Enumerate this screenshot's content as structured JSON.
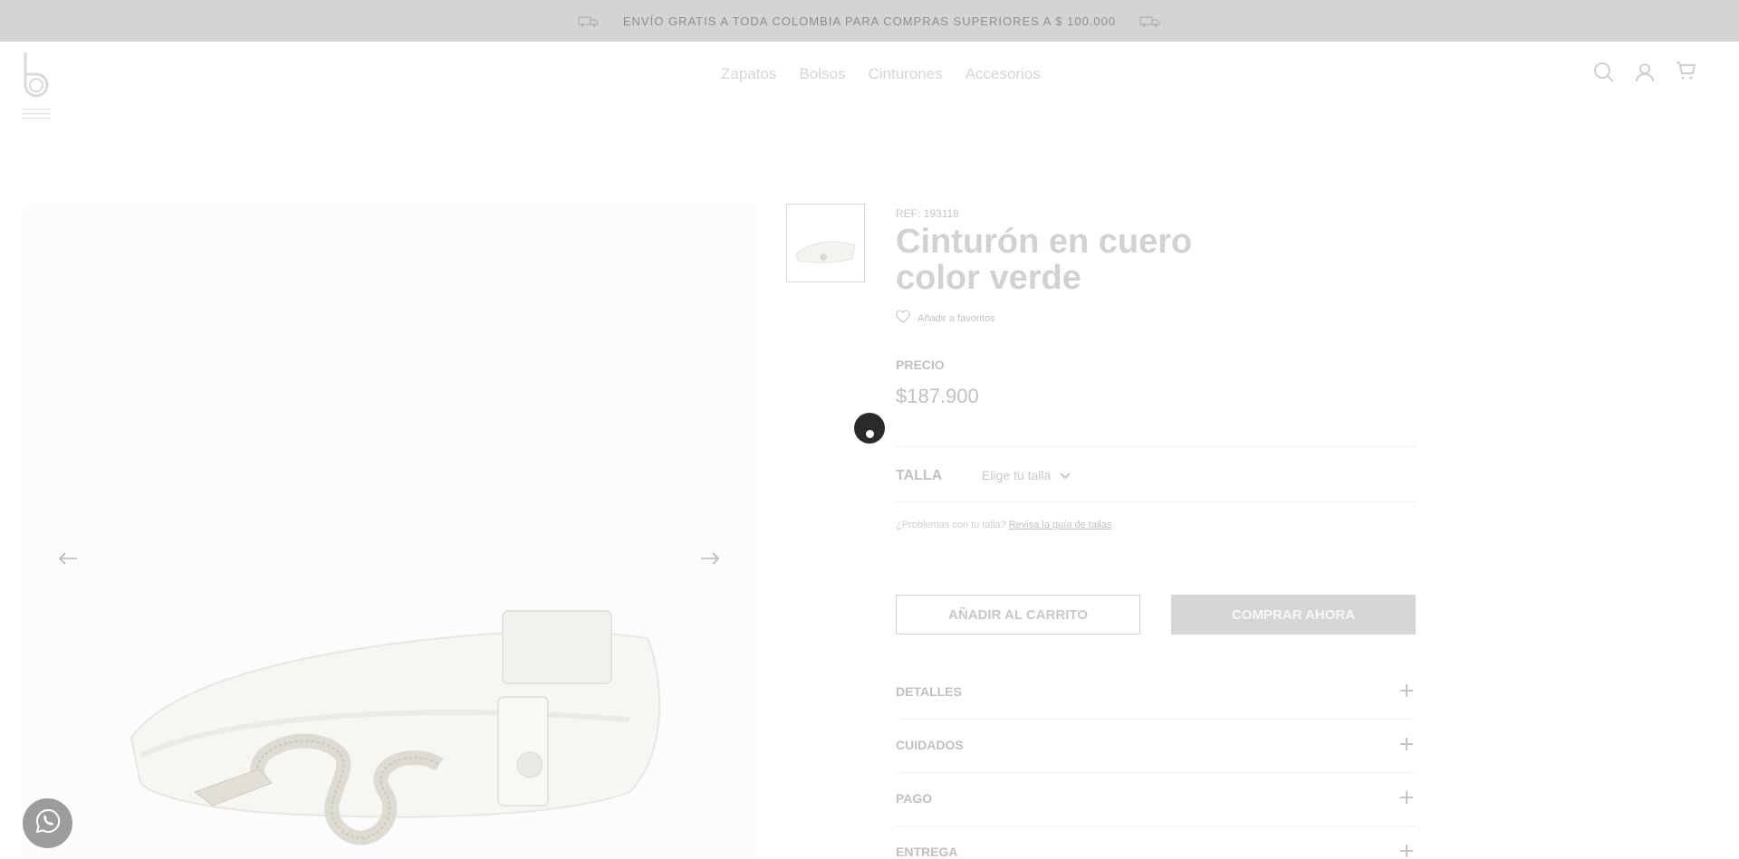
{
  "announcement": {
    "text": "ENVÍO GRATIS A TODA COLOMBIA PARA COMPRAS SUPERIORES A $ 100.000",
    "icon": "truck-icon"
  },
  "header": {
    "logo": "b",
    "nav": [
      "Zapatos",
      "Bolsos",
      "Cinturones",
      "Accesorios"
    ],
    "icons": [
      "search-icon",
      "user-icon",
      "cart-icon"
    ]
  },
  "product": {
    "ref": "REF: 193118",
    "title": "Cinturón en cuero color verde",
    "favorites_label": "Añadir a favoritos",
    "price_label": "PRECIO",
    "price": "$187.900",
    "size_label": "TALLA",
    "size_placeholder": "Elige tu talla",
    "help_text": "¿Problemas con tu talla?",
    "help_link": "Revisa la guía de tallas",
    "add_to_cart": "AÑADIR AL CARRITO",
    "buy_now": "COMPRAR AHORA"
  },
  "accordion": [
    "DETALLES",
    "CUIDADOS",
    "PAGO",
    "ENTREGA"
  ],
  "colors": {
    "announcement_bg": "#d4d4d4",
    "buy_button_bg": "#d6d6d6",
    "whatsapp_bg": "#9c9c9c"
  }
}
